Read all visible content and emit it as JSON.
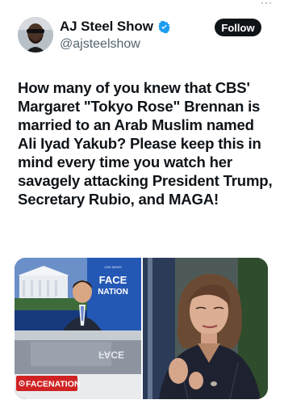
{
  "author": {
    "name": "AJ Steel Show",
    "handle": "@ajsteelshow",
    "verified": true,
    "verified_icon": "verified-badge-icon"
  },
  "follow_button": {
    "label": "Follow"
  },
  "tweet_text": "How many of you knew that CBS' Margaret \"Tokyo Rose\" Brennan is married to an Arab Muslim named Ali Iyad Yakub? Please keep this in mind every time you watch her savagely attacking President Trump, Secretary Rubio, and MAGA!",
  "media": {
    "left_logo_top": "FACE",
    "left_logo_bottom": "NATION",
    "left_lower_third": "FACE⁠NATION",
    "left_network": "CBS NEWS"
  },
  "colors": {
    "text": "#0f1419",
    "secondary": "#536471",
    "button_bg": "#0f1419",
    "verified_blue": "#1d9bf0"
  }
}
